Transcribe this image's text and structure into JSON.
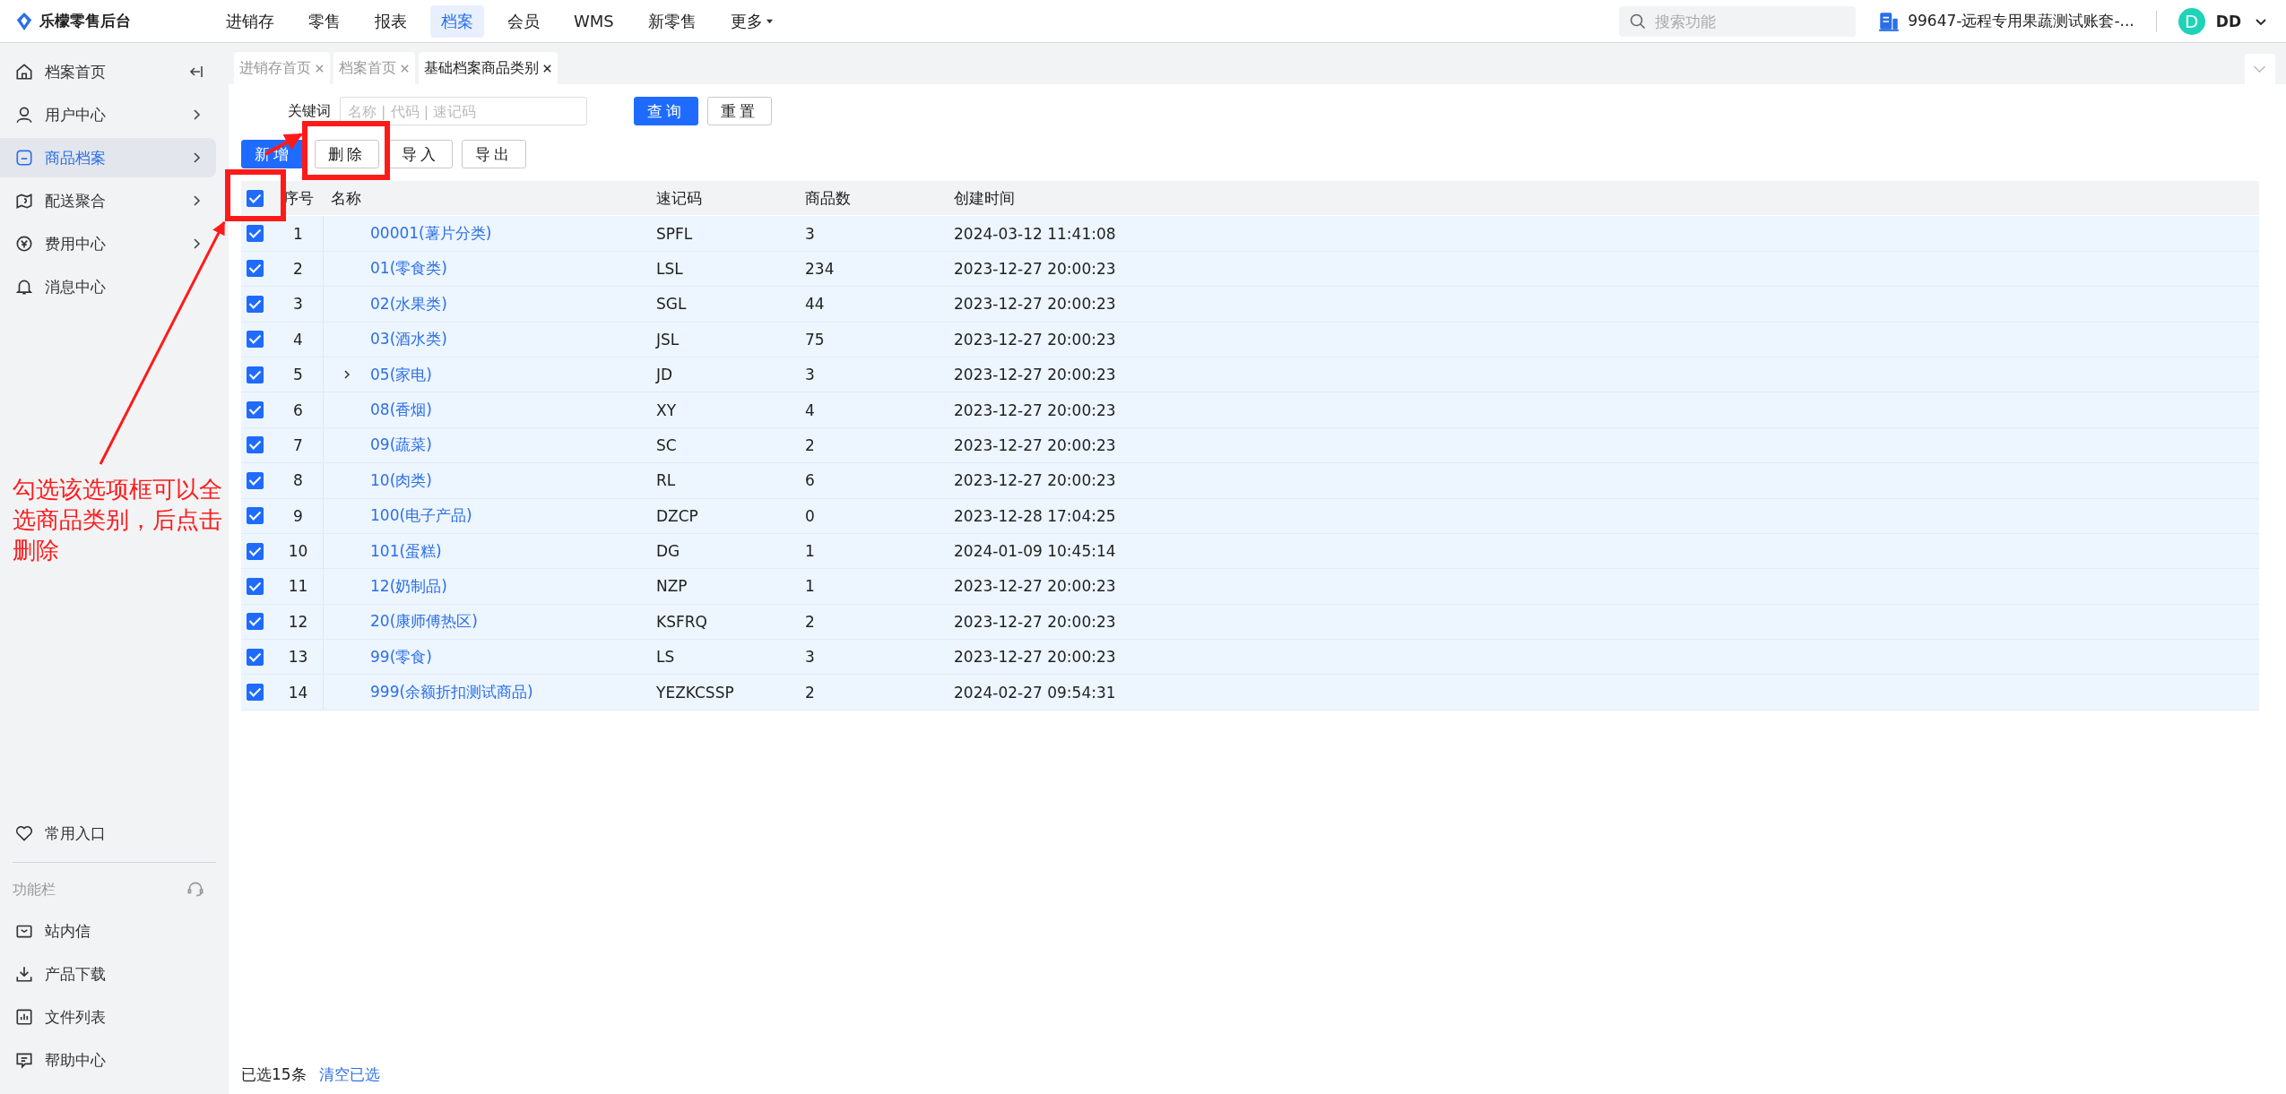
{
  "app": {
    "title": "乐檬零售后台"
  },
  "nav": [
    {
      "label": "进销存",
      "selected": false,
      "has_dropdown": false
    },
    {
      "label": "零售",
      "selected": false,
      "has_dropdown": false
    },
    {
      "label": "报表",
      "selected": false,
      "has_dropdown": false
    },
    {
      "label": "档案",
      "selected": true,
      "has_dropdown": false
    },
    {
      "label": "会员",
      "selected": false,
      "has_dropdown": false
    },
    {
      "label": "WMS",
      "selected": false,
      "has_dropdown": false
    },
    {
      "label": "新零售",
      "selected": false,
      "has_dropdown": false
    },
    {
      "label": "更多",
      "selected": false,
      "has_dropdown": true
    }
  ],
  "search": {
    "placeholder": "搜索功能"
  },
  "account": {
    "name": "99647-远程专用果蔬测试账套-..."
  },
  "user": {
    "avatar": "D",
    "name": "DD"
  },
  "sidebar": {
    "items": [
      {
        "label": "档案首页",
        "selected": false,
        "kind": "collapse"
      },
      {
        "label": "用户中心",
        "selected": false,
        "kind": "submenu"
      },
      {
        "label": "商品档案",
        "selected": true,
        "kind": "submenu"
      },
      {
        "label": "配送聚合",
        "selected": false,
        "kind": "submenu"
      },
      {
        "label": "费用中心",
        "selected": false,
        "kind": "submenu"
      },
      {
        "label": "消息中心",
        "selected": false,
        "kind": "plain"
      }
    ],
    "favorites": {
      "label": "常用入口"
    },
    "toolbar": {
      "title": "功能栏",
      "items": [
        {
          "label": "站内信"
        },
        {
          "label": "产品下载"
        },
        {
          "label": "文件列表"
        },
        {
          "label": "帮助中心"
        }
      ]
    }
  },
  "tabs": [
    {
      "label": "进销存首页",
      "selected": false
    },
    {
      "label": "档案首页",
      "selected": false
    },
    {
      "label": "基础档案商品类别",
      "selected": true
    }
  ],
  "filter": {
    "label": "关键词",
    "placeholder": "名称 | 代码 | 速记码",
    "buttons": [
      {
        "label": "查询",
        "kind": "primary"
      },
      {
        "label": "重置",
        "kind": "default"
      }
    ]
  },
  "actions": [
    {
      "label": "新增",
      "kind": "primary"
    },
    {
      "label": "删除",
      "kind": "default"
    },
    {
      "label": "导入",
      "kind": "default"
    },
    {
      "label": "导出",
      "kind": "default"
    }
  ],
  "table": {
    "all_checked": true,
    "columns": [
      "序号",
      "名称",
      "速记码",
      "商品数",
      "创建时间"
    ],
    "rows": [
      {
        "index": "1",
        "name": "00001(薯片分类)",
        "code": "SPFL",
        "count": "3",
        "created": "2024-03-12 11:41:08",
        "checked": true,
        "expandable": false
      },
      {
        "index": "2",
        "name": "01(零食类)",
        "code": "LSL",
        "count": "234",
        "created": "2023-12-27 20:00:23",
        "checked": true,
        "expandable": false
      },
      {
        "index": "3",
        "name": "02(水果类)",
        "code": "SGL",
        "count": "44",
        "created": "2023-12-27 20:00:23",
        "checked": true,
        "expandable": false
      },
      {
        "index": "4",
        "name": "03(酒水类)",
        "code": "JSL",
        "count": "75",
        "created": "2023-12-27 20:00:23",
        "checked": true,
        "expandable": false
      },
      {
        "index": "5",
        "name": "05(家电)",
        "code": "JD",
        "count": "3",
        "created": "2023-12-27 20:00:23",
        "checked": true,
        "expandable": true
      },
      {
        "index": "6",
        "name": "08(香烟)",
        "code": "XY",
        "count": "4",
        "created": "2023-12-27 20:00:23",
        "checked": true,
        "expandable": false
      },
      {
        "index": "7",
        "name": "09(蔬菜)",
        "code": "SC",
        "count": "2",
        "created": "2023-12-27 20:00:23",
        "checked": true,
        "expandable": false
      },
      {
        "index": "8",
        "name": "10(肉类)",
        "code": "RL",
        "count": "6",
        "created": "2023-12-27 20:00:23",
        "checked": true,
        "expandable": false
      },
      {
        "index": "9",
        "name": "100(电子产品)",
        "code": "DZCP",
        "count": "0",
        "created": "2023-12-28 17:04:25",
        "checked": true,
        "expandable": false
      },
      {
        "index": "10",
        "name": "101(蛋糕)",
        "code": "DG",
        "count": "1",
        "created": "2024-01-09 10:45:14",
        "checked": true,
        "expandable": false
      },
      {
        "index": "11",
        "name": "12(奶制品)",
        "code": "NZP",
        "count": "1",
        "created": "2023-12-27 20:00:23",
        "checked": true,
        "expandable": false
      },
      {
        "index": "12",
        "name": "20(康师傅热区)",
        "code": "KSFRQ",
        "count": "2",
        "created": "2023-12-27 20:00:23",
        "checked": true,
        "expandable": false
      },
      {
        "index": "13",
        "name": "99(零食)",
        "code": "LS",
        "count": "3",
        "created": "2023-12-27 20:00:23",
        "checked": true,
        "expandable": false
      },
      {
        "index": "14",
        "name": "999(余额折扣测试商品)",
        "code": "YEZKCSSP",
        "count": "2",
        "created": "2024-02-27 09:54:31",
        "checked": true,
        "expandable": false
      }
    ]
  },
  "footer": {
    "selected_count": "已选15条",
    "clear": "清空已选"
  },
  "annotation": {
    "note": "勾选该选项框可以全选商品类别，后点击删除"
  }
}
